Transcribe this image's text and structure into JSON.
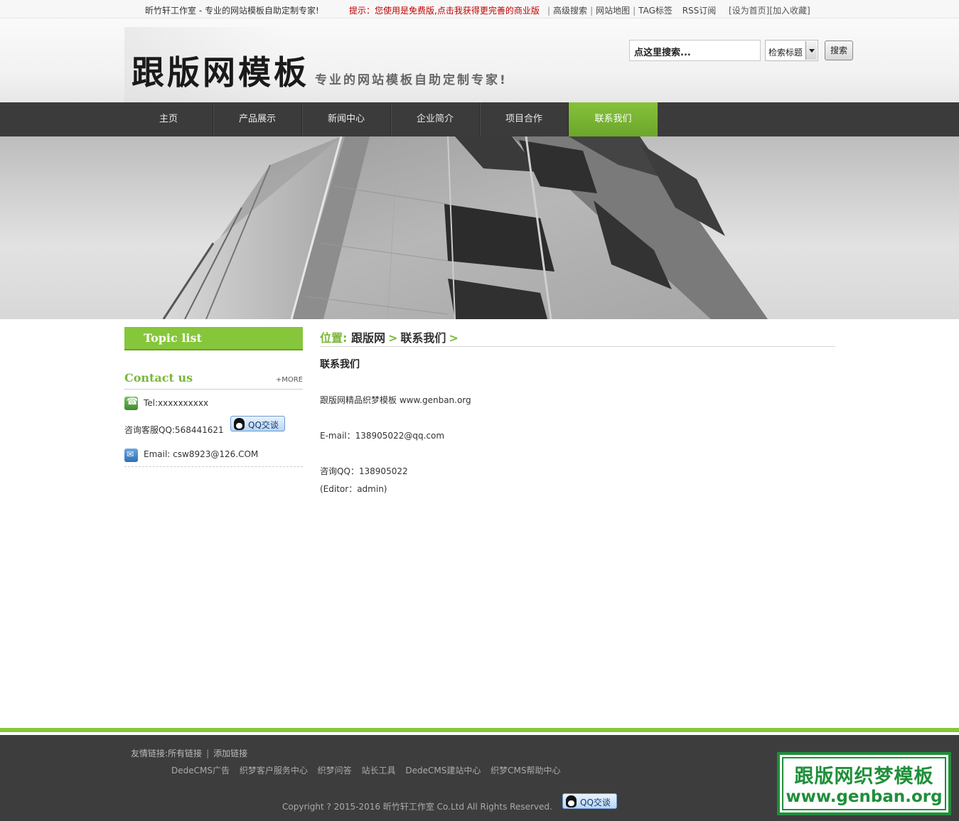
{
  "topbar": {
    "slogan": "昕竹轩工作室 - 专业的网站模板自助定制专家!",
    "notice": "提示：您使用是免费版,点击我获得更完善的商业版",
    "links": [
      "高级搜索",
      "网站地图",
      "TAG标签",
      "RSS订阅"
    ],
    "set_home": "[设为首页]",
    "add_fav": "[加入收藏]"
  },
  "header": {
    "logo_text": "跟版网模板",
    "logo_tagline": "专业的网站模板自助定制专家!",
    "search_placeholder": "点这里搜索...",
    "search_scope": "检索标题",
    "search_button": "搜索"
  },
  "nav": {
    "items": [
      "主页",
      "产品展示",
      "新闻中心",
      "企业简介",
      "项目合作",
      "联系我们"
    ],
    "active_index": 5
  },
  "sidebar": {
    "topic_list": "Topic list",
    "contact_title": "Contact us",
    "more": "+MORE",
    "tel": "Tel:xxxxxxxxxx",
    "qq_service": "咨询客服QQ:568441621",
    "qq_button": "QQ交谈",
    "email": "Email: csw8923@126.COM"
  },
  "main": {
    "crumb_label": "位置:",
    "crumbs": [
      "跟版网",
      "联系我们"
    ],
    "title": "联系我们",
    "lines": [
      "跟版网精品织梦模板 www.genban.org",
      "E-mail：138905022@qq.com",
      "咨询QQ：138905022",
      "(Editor：admin)"
    ]
  },
  "footer": {
    "friend_label": "友情链接:",
    "all_links": "所有链接",
    "add_link": "添加链接",
    "links": [
      "DedeCMS广告",
      "织梦客户服务中心",
      "织梦问答",
      "站长工具",
      "DedeCMS建站中心",
      "织梦CMS帮助中心"
    ],
    "copyright": "Copyright ? 2015-2016 昕竹轩工作室 Co.Ltd All Rights Reserved.",
    "qq_button": "QQ交谈"
  },
  "watermark": {
    "line1": "跟版网织梦模板",
    "line2": "www.genban.org"
  },
  "colors": {
    "accent_green": "#86c63a",
    "nav_dark": "#3b3b3b",
    "notice_red": "#c00000"
  }
}
